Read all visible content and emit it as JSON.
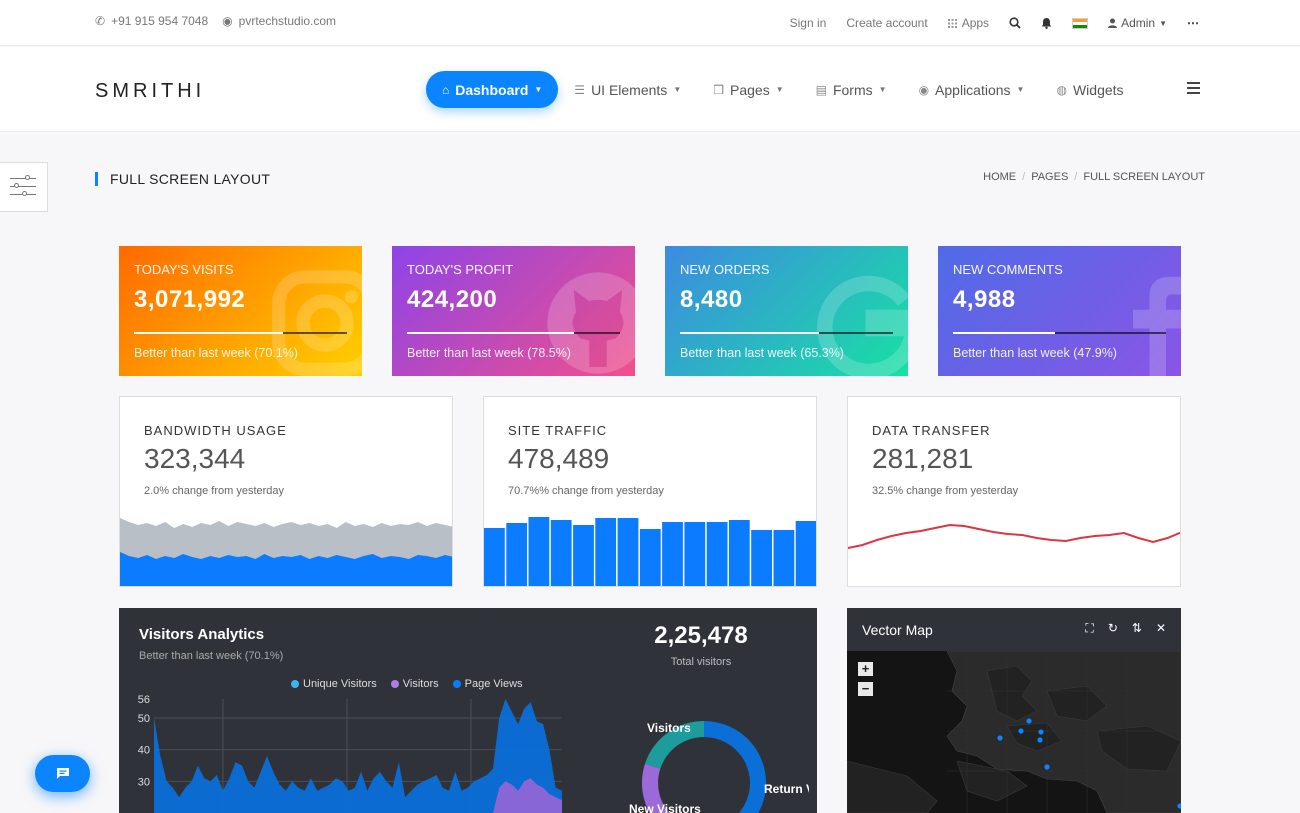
{
  "topbar": {
    "phone": "+91 915 954 7048",
    "website": "pvrtechstudio.com",
    "sign_in": "Sign in",
    "create_account": "Create account",
    "apps": "Apps",
    "admin": "Admin"
  },
  "header": {
    "logo": "SMRITHI",
    "nav": [
      {
        "label": "Dashboard",
        "icon": "home-icon"
      },
      {
        "label": "UI Elements",
        "icon": "list-icon"
      },
      {
        "label": "Pages",
        "icon": "book-icon"
      },
      {
        "label": "Forms",
        "icon": "form-icon"
      },
      {
        "label": "Applications",
        "icon": "grid-icon"
      },
      {
        "label": "Widgets",
        "icon": "widget-icon"
      }
    ]
  },
  "page": {
    "title": "FULL SCREEN LAYOUT",
    "breadcrumb": [
      "HOME",
      "PAGES",
      "FULL SCREEN LAYOUT"
    ]
  },
  "stats": [
    {
      "label": "TODAY'S VISITS",
      "value": "3,071,992",
      "note": "Better than last week (70.1%)",
      "progress": 0.701,
      "from": "#ff6a00",
      "to": "#ffd000",
      "icon": "instagram-icon"
    },
    {
      "label": "TODAY'S PROFIT",
      "value": "424,200",
      "note": "Better than last week (78.5%)",
      "progress": 0.785,
      "from": "#8e44e8",
      "to": "#f0508a",
      "icon": "github-icon"
    },
    {
      "label": "NEW ORDERS",
      "value": "8,480",
      "note": "Better than last week (65.3%)",
      "progress": 0.653,
      "from": "#3d8be0",
      "to": "#18e0a4",
      "icon": "google-icon"
    },
    {
      "label": "NEW COMMENTS",
      "value": "4,988",
      "note": "Better than last week (47.9%)",
      "progress": 0.479,
      "from": "#4f6be6",
      "to": "#8a55e6",
      "icon": "facebook-icon"
    }
  ],
  "minicards": [
    {
      "title": "BANDWIDTH USAGE",
      "value": "323,344",
      "note": "2.0% change from yesterday"
    },
    {
      "title": "SITE TRAFFIC",
      "value": "478,489",
      "note": "70.7%% change from yesterday"
    },
    {
      "title": "DATA TRANSFER",
      "value": "281,281",
      "note": "32.5% change from yesterday"
    }
  ],
  "chart_data": [
    {
      "type": "area",
      "series": [
        {
          "color": "#b8bfc6",
          "values": [
            68,
            64,
            61,
            63,
            60,
            64,
            58,
            62,
            59,
            63,
            61,
            65,
            60,
            64,
            62,
            60,
            63,
            59,
            62,
            64,
            61,
            63,
            60,
            62,
            58,
            64,
            60,
            62,
            59,
            63,
            60,
            62,
            61,
            64,
            60,
            63,
            61,
            59
          ]
        },
        {
          "color": "#0b7cff",
          "values": [
            34,
            30,
            28,
            31,
            27,
            30,
            28,
            32,
            29,
            27,
            30,
            28,
            31,
            29,
            30,
            27,
            32,
            28,
            30,
            29,
            31,
            27,
            30,
            28,
            31,
            29,
            27,
            30,
            32,
            28,
            30,
            29,
            27,
            31,
            30,
            28,
            31,
            29
          ]
        }
      ]
    },
    {
      "type": "bar",
      "color": "#0b7cff",
      "values": [
        58,
        63,
        69,
        66,
        61,
        68,
        68,
        57,
        64,
        64,
        64,
        66,
        56,
        56,
        65
      ]
    },
    {
      "type": "line",
      "color": "#dc3545",
      "values": [
        38,
        41,
        46,
        50,
        53,
        55,
        58,
        61,
        60,
        57,
        54,
        52,
        51,
        48,
        46,
        45,
        48,
        50,
        51,
        53,
        48,
        44,
        48,
        54
      ]
    },
    {
      "type": "area",
      "title": "Visitors Analytics",
      "legend": [
        "Unique Visitors",
        "Visitors",
        "Page Views"
      ],
      "ticks": [
        "56",
        "50",
        "40",
        "30"
      ],
      "series": [
        {
          "name": "Page Views",
          "color": "#0b6fd8",
          "values": [
            50,
            38,
            30,
            28,
            25,
            28,
            30,
            35,
            31,
            30,
            32,
            27,
            31,
            36,
            35,
            30,
            28,
            33,
            38,
            33,
            29,
            27,
            30,
            28,
            27,
            31,
            27,
            28,
            29,
            31,
            30,
            27,
            28,
            33,
            27,
            31,
            33,
            30,
            28,
            36,
            25,
            27,
            29,
            30,
            31,
            32,
            28,
            27,
            33,
            27,
            28,
            30,
            31,
            32,
            34,
            50,
            56,
            52,
            48,
            53,
            55,
            49,
            48,
            40,
            28,
            27
          ]
        },
        {
          "name": "Visitors",
          "color": "#8f66d6",
          "values": [
            0,
            0,
            0,
            0,
            0,
            0,
            0,
            0,
            0,
            0,
            0,
            0,
            0,
            0,
            0,
            0,
            0,
            0,
            0,
            0,
            0,
            0,
            0,
            0,
            0,
            0,
            0,
            0,
            0,
            0,
            0,
            0,
            0,
            0,
            0,
            0,
            0,
            0,
            0,
            0,
            0,
            0,
            0,
            0,
            0,
            0,
            0,
            0,
            0,
            0,
            0,
            0,
            0,
            0,
            0,
            28,
            30,
            29,
            27,
            30,
            31,
            29,
            28,
            26,
            25,
            24
          ]
        }
      ]
    },
    {
      "type": "pie",
      "categories": [
        "Return Visitors",
        "Visitors",
        "New Visitors"
      ],
      "values": [
        62,
        18,
        20
      ],
      "colors": [
        "#0b6fd8",
        "#9b6ad8",
        "#1e9c9c"
      ]
    }
  ],
  "analytics": {
    "title": "Visitors Analytics",
    "subtitle": "Better than last week (70.1%)",
    "legend": [
      {
        "label": "Unique Visitors",
        "color": "#3bb4f2"
      },
      {
        "label": "Visitors",
        "color": "#b07ce8"
      },
      {
        "label": "Page Views",
        "color": "#0b7cff"
      }
    ],
    "total_value": "2,25,478",
    "total_label": "Total visitors",
    "donut_labels": [
      "Visitors",
      "Return Visitors",
      "New Visitors"
    ]
  },
  "vmap": {
    "title": "Vector Map",
    "zoom_in": "+",
    "zoom_out": "−"
  }
}
